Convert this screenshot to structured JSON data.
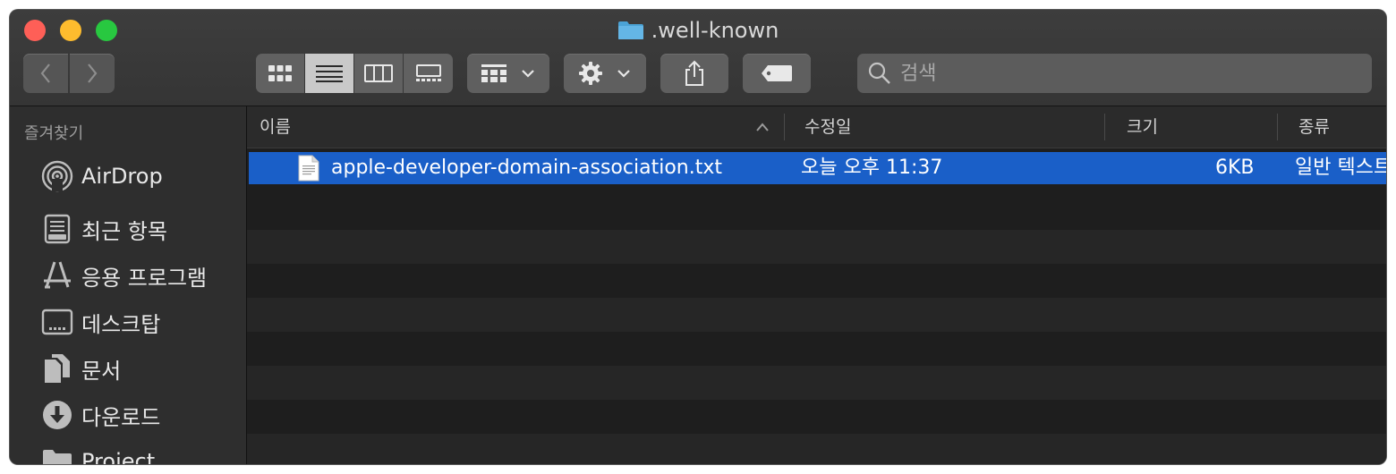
{
  "window": {
    "title": ".well-known"
  },
  "toolbar": {
    "view_modes": [
      "icon-view",
      "list-view",
      "column-view",
      "gallery-view"
    ],
    "active_view": "list-view",
    "search_placeholder": "검색"
  },
  "sidebar": {
    "header": "즐겨찾기",
    "items": [
      {
        "label": "AirDrop",
        "icon": "airdrop-icon"
      },
      {
        "label": "최근 항목",
        "icon": "recents-icon"
      },
      {
        "label": "응용 프로그램",
        "icon": "applications-icon"
      },
      {
        "label": "데스크탑",
        "icon": "desktop-icon"
      },
      {
        "label": "문서",
        "icon": "documents-icon"
      },
      {
        "label": "다운로드",
        "icon": "downloads-icon"
      },
      {
        "label": "Project",
        "icon": "folder-icon"
      }
    ]
  },
  "columns": {
    "name": "이름",
    "modified": "수정일",
    "size": "크기",
    "kind": "종류"
  },
  "files": [
    {
      "name": "apple-developer-domain-association.txt",
      "modified": "오늘 오후 11:37",
      "size": "6KB",
      "kind": "일반 텍스트",
      "selected": true
    }
  ],
  "colors": {
    "selection": "#1a5fc8",
    "close": "#fe5f57",
    "minimize": "#febc2e",
    "maximize": "#28c840"
  }
}
